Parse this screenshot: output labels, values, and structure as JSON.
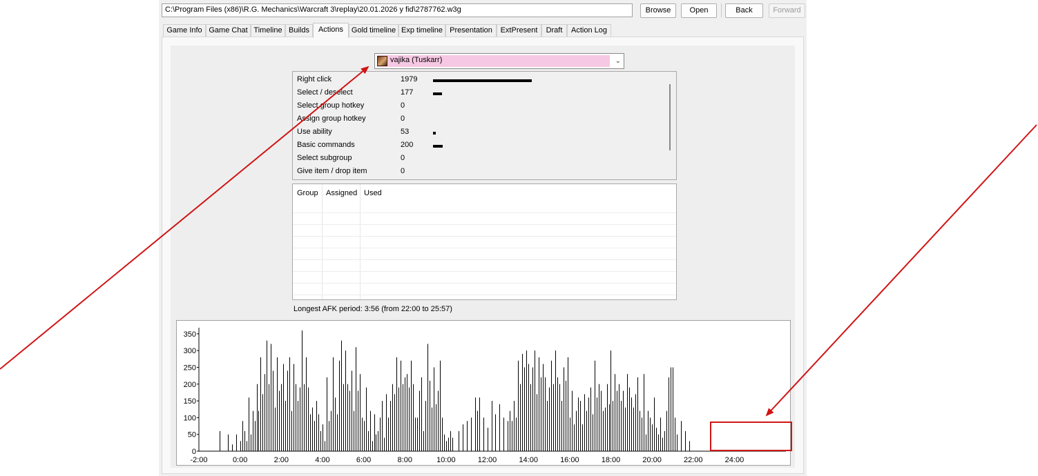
{
  "toolbar": {
    "path_value": "C:\\Program Files (x86)\\R.G. Mechanics\\Warcraft 3\\replay\\20.01.2026 y fid\\2787762.w3g",
    "browse_label": "Browse",
    "open_label": "Open",
    "back_label": "Back",
    "forward_label": "Forward"
  },
  "tabs": [
    {
      "label": "Game Info"
    },
    {
      "label": "Game Chat"
    },
    {
      "label": "Timeline"
    },
    {
      "label": "Builds"
    },
    {
      "label": "Actions",
      "active": true
    },
    {
      "label": "Gold timeline"
    },
    {
      "label": "Exp timeline"
    },
    {
      "label": "Presentation"
    },
    {
      "label": "ExtPresent"
    },
    {
      "label": "Draft"
    },
    {
      "label": "Action Log"
    }
  ],
  "player_select": {
    "selected": "vajika (Tuskarr)",
    "highlight_color": "#f6c8e3",
    "icon": "hero-portrait-icon"
  },
  "actions": [
    {
      "name": "Right click",
      "count": 1979
    },
    {
      "name": "Select / deselect",
      "count": 177
    },
    {
      "name": "Select group hotkey",
      "count": 0
    },
    {
      "name": "Assign group hotkey",
      "count": 0
    },
    {
      "name": "Use ability",
      "count": 53
    },
    {
      "name": "Basic commands",
      "count": 200
    },
    {
      "name": "Select subgroup",
      "count": 0
    },
    {
      "name": "Give item / drop item",
      "count": 0
    }
  ],
  "hotkey_table": {
    "columns": [
      "Group",
      "Assigned",
      "Used"
    ],
    "rows": []
  },
  "afk_text": "Longest AFK period: 3:56 (from 22:00 to 25:57)",
  "chart_data": {
    "type": "bar",
    "title": "",
    "xlabel": "",
    "ylabel": "",
    "ylim": [
      0,
      360
    ],
    "yticks": [
      0,
      50,
      100,
      150,
      200,
      250,
      300,
      350
    ],
    "xlim": [
      -2,
      26.5
    ],
    "xtick_labels": [
      "-2:00",
      "0:00",
      "2:00",
      "4:00",
      "6:00",
      "8:00",
      "10:00",
      "12:00",
      "14:00",
      "16:00",
      "18:00",
      "20:00",
      "22:00",
      "24:00"
    ],
    "bar_color": "#000000",
    "series": [
      {
        "values": [
          [
            -1,
            60
          ],
          [
            -0.6,
            50
          ],
          [
            -0.4,
            20
          ],
          [
            -0.2,
            50
          ],
          [
            0,
            30
          ],
          [
            0.1,
            90
          ],
          [
            0.2,
            60
          ],
          [
            0.3,
            30
          ],
          [
            0.4,
            160
          ],
          [
            0.5,
            50
          ],
          [
            0.6,
            120
          ],
          [
            0.7,
            90
          ],
          [
            0.8,
            200
          ],
          [
            0.9,
            120
          ],
          [
            1.0,
            280
          ],
          [
            1.1,
            170
          ],
          [
            1.2,
            230
          ],
          [
            1.3,
            330
          ],
          [
            1.4,
            200
          ],
          [
            1.5,
            320
          ],
          [
            1.6,
            240
          ],
          [
            1.7,
            130
          ],
          [
            1.8,
            280
          ],
          [
            1.9,
            180
          ],
          [
            2.0,
            200
          ],
          [
            2.1,
            260
          ],
          [
            2.2,
            150
          ],
          [
            2.3,
            240
          ],
          [
            2.4,
            280
          ],
          [
            2.5,
            120
          ],
          [
            2.6,
            260
          ],
          [
            2.7,
            200
          ],
          [
            2.8,
            150
          ],
          [
            2.9,
            190
          ],
          [
            3.0,
            360
          ],
          [
            3.1,
            200
          ],
          [
            3.2,
            280
          ],
          [
            3.3,
            190
          ],
          [
            3.4,
            110
          ],
          [
            3.5,
            130
          ],
          [
            3.6,
            90
          ],
          [
            3.7,
            150
          ],
          [
            3.8,
            110
          ],
          [
            3.9,
            60
          ],
          [
            4.0,
            80
          ],
          [
            4.1,
            30
          ],
          [
            4.2,
            220
          ],
          [
            4.3,
            90
          ],
          [
            4.4,
            120
          ],
          [
            4.5,
            280
          ],
          [
            4.6,
            160
          ],
          [
            4.7,
            110
          ],
          [
            4.8,
            270
          ],
          [
            4.9,
            330
          ],
          [
            5.0,
            200
          ],
          [
            5.1,
            300
          ],
          [
            5.2,
            200
          ],
          [
            5.3,
            180
          ],
          [
            5.4,
            240
          ],
          [
            5.5,
            120
          ],
          [
            5.6,
            310
          ],
          [
            5.7,
            180
          ],
          [
            5.8,
            230
          ],
          [
            5.9,
            100
          ],
          [
            6.0,
            90
          ],
          [
            6.1,
            190
          ],
          [
            6.2,
            60
          ],
          [
            6.3,
            120
          ],
          [
            6.4,
            30
          ],
          [
            6.5,
            110
          ],
          [
            6.6,
            50
          ],
          [
            6.7,
            60
          ],
          [
            6.8,
            100
          ],
          [
            6.9,
            150
          ],
          [
            7.0,
            40
          ],
          [
            7.1,
            170
          ],
          [
            7.2,
            100
          ],
          [
            7.3,
            150
          ],
          [
            7.4,
            200
          ],
          [
            7.5,
            170
          ],
          [
            7.6,
            280
          ],
          [
            7.7,
            190
          ],
          [
            7.8,
            270
          ],
          [
            7.9,
            200
          ],
          [
            8.0,
            220
          ],
          [
            8.1,
            230
          ],
          [
            8.2,
            190
          ],
          [
            8.3,
            270
          ],
          [
            8.4,
            200
          ],
          [
            8.5,
            100
          ],
          [
            8.6,
            100
          ],
          [
            8.7,
            180
          ],
          [
            8.8,
            220
          ],
          [
            8.9,
            60
          ],
          [
            9.0,
            150
          ],
          [
            9.1,
            320
          ],
          [
            9.2,
            210
          ],
          [
            9.3,
            130
          ],
          [
            9.4,
            250
          ],
          [
            9.5,
            140
          ],
          [
            9.6,
            180
          ],
          [
            9.7,
            270
          ],
          [
            9.8,
            100
          ],
          [
            9.9,
            50
          ],
          [
            10.0,
            30
          ],
          [
            10.1,
            40
          ],
          [
            10.2,
            60
          ],
          [
            10.3,
            40
          ],
          [
            10.6,
            60
          ],
          [
            10.8,
            80
          ],
          [
            11.0,
            90
          ],
          [
            11.2,
            100
          ],
          [
            11.4,
            160
          ],
          [
            11.5,
            120
          ],
          [
            11.6,
            160
          ],
          [
            11.8,
            100
          ],
          [
            12.0,
            70
          ],
          [
            12.2,
            150
          ],
          [
            12.4,
            110
          ],
          [
            12.6,
            140
          ],
          [
            12.8,
            100
          ],
          [
            13.0,
            90
          ],
          [
            13.1,
            120
          ],
          [
            13.2,
            90
          ],
          [
            13.3,
            150
          ],
          [
            13.4,
            100
          ],
          [
            13.5,
            270
          ],
          [
            13.6,
            200
          ],
          [
            13.7,
            290
          ],
          [
            13.8,
            250
          ],
          [
            13.9,
            300
          ],
          [
            14.0,
            260
          ],
          [
            14.1,
            200
          ],
          [
            14.2,
            250
          ],
          [
            14.3,
            300
          ],
          [
            14.4,
            170
          ],
          [
            14.5,
            280
          ],
          [
            14.6,
            220
          ],
          [
            14.7,
            260
          ],
          [
            14.8,
            220
          ],
          [
            14.9,
            150
          ],
          [
            15.0,
            190
          ],
          [
            15.1,
            270
          ],
          [
            15.2,
            200
          ],
          [
            15.3,
            300
          ],
          [
            15.4,
            220
          ],
          [
            15.5,
            200
          ],
          [
            15.6,
            150
          ],
          [
            15.7,
            250
          ],
          [
            15.8,
            210
          ],
          [
            15.9,
            280
          ],
          [
            16.0,
            100
          ],
          [
            16.1,
            180
          ],
          [
            16.2,
            80
          ],
          [
            16.3,
            120
          ],
          [
            16.4,
            160
          ],
          [
            16.5,
            150
          ],
          [
            16.6,
            80
          ],
          [
            16.7,
            170
          ],
          [
            16.8,
            120
          ],
          [
            16.9,
            160
          ],
          [
            17.0,
            190
          ],
          [
            17.1,
            110
          ],
          [
            17.2,
            270
          ],
          [
            17.3,
            160
          ],
          [
            17.4,
            200
          ],
          [
            17.5,
            180
          ],
          [
            17.6,
            120
          ],
          [
            17.7,
            130
          ],
          [
            17.8,
            200
          ],
          [
            17.9,
            140
          ],
          [
            18.0,
            300
          ],
          [
            18.1,
            150
          ],
          [
            18.2,
            230
          ],
          [
            18.3,
            180
          ],
          [
            18.4,
            200
          ],
          [
            18.5,
            150
          ],
          [
            18.6,
            180
          ],
          [
            18.7,
            130
          ],
          [
            18.8,
            230
          ],
          [
            18.9,
            190
          ],
          [
            19.0,
            160
          ],
          [
            19.1,
            130
          ],
          [
            19.2,
            170
          ],
          [
            19.3,
            220
          ],
          [
            19.4,
            120
          ],
          [
            19.5,
            100
          ],
          [
            19.6,
            230
          ],
          [
            19.7,
            50
          ],
          [
            19.8,
            120
          ],
          [
            19.9,
            100
          ],
          [
            20.0,
            80
          ],
          [
            20.1,
            160
          ],
          [
            20.2,
            70
          ],
          [
            20.3,
            50
          ],
          [
            20.4,
            100
          ],
          [
            20.5,
            40
          ],
          [
            20.6,
            60
          ],
          [
            20.7,
            120
          ],
          [
            20.8,
            220
          ],
          [
            20.9,
            250
          ],
          [
            21.0,
            250
          ],
          [
            21.1,
            100
          ],
          [
            21.2,
            50
          ],
          [
            21.4,
            90
          ],
          [
            21.6,
            60
          ],
          [
            21.8,
            30
          ]
        ]
      }
    ]
  }
}
